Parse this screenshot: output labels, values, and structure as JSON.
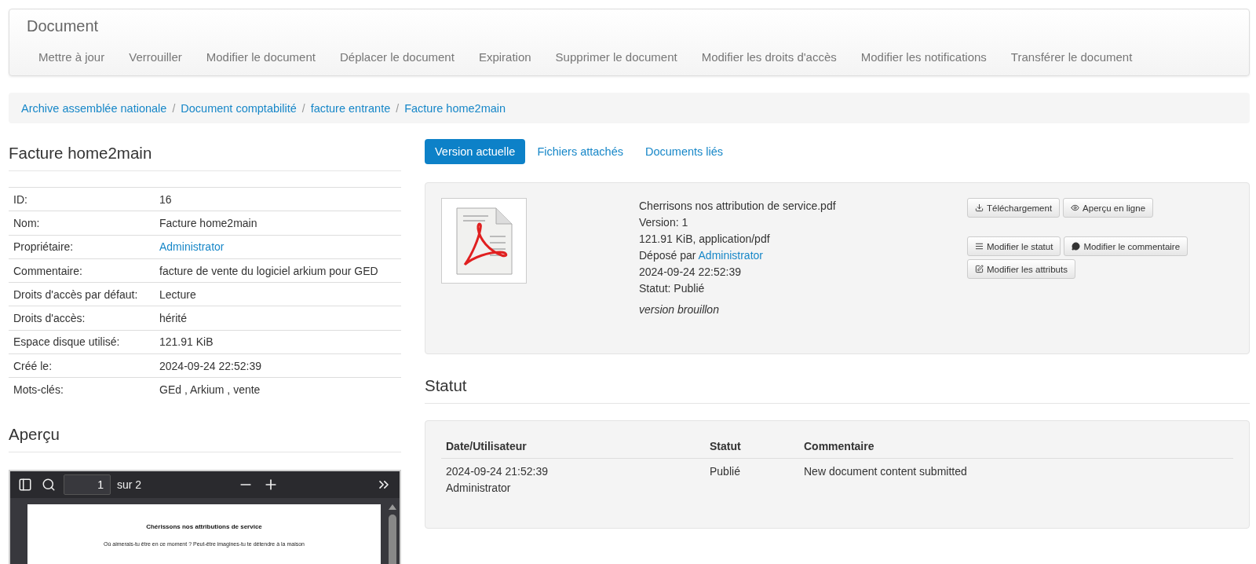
{
  "navbar": {
    "title": "Document",
    "items": [
      "Mettre à jour",
      "Verrouiller",
      "Modifier le document",
      "Déplacer le document",
      "Expiration",
      "Supprimer le document",
      "Modifier les droits d'accès",
      "Modifier les notifications",
      "Transférer le document"
    ]
  },
  "breadcrumb_separator": "/",
  "breadcrumb": [
    "Archive assemblée nationale",
    "Document comptabilité",
    "facture entrante",
    "Facture home2main"
  ],
  "details": {
    "title": "Facture home2main",
    "rows": [
      {
        "label": "ID:",
        "value": "16",
        "kind": "text"
      },
      {
        "label": "Nom:",
        "value": "Facture home2main",
        "kind": "text"
      },
      {
        "label": "Propriétaire:",
        "value": "Administrator",
        "kind": "link"
      },
      {
        "label": "Commentaire:",
        "value": "facture de vente du logiciel arkium pour GED",
        "kind": "text"
      },
      {
        "label": "Droits d'accès par défaut:",
        "value": "Lecture",
        "kind": "text"
      },
      {
        "label": "Droits d'accès:",
        "value": "hérité",
        "kind": "text"
      },
      {
        "label": "Espace disque utilisé:",
        "value": "121.91 KiB",
        "kind": "text"
      },
      {
        "label": "Créé le:",
        "value": "2024-09-24 22:52:39",
        "kind": "text"
      },
      {
        "label": "Mots-clés:",
        "value": "GEd , Arkium , vente",
        "kind": "text"
      }
    ]
  },
  "preview": {
    "title": "Aperçu",
    "viewer": {
      "page": "1",
      "page_count": "sur 2",
      "doc_title": "Chérissons nos attributions de service",
      "doc_text": "Où aimerais-tu être en ce moment ? Peut-être imagines-tu te détendre à la maison"
    }
  },
  "tabs": [
    {
      "label": "Version actuelle",
      "selected": true
    },
    {
      "label": "Fichiers attachés",
      "selected": false
    },
    {
      "label": "Documents liés",
      "selected": false
    }
  ],
  "version": {
    "filename": "Cherrisons nos attribution de service.pdf",
    "version": "Version: 1",
    "size": "121.91 KiB, application/pdf",
    "uploaded_label": "Déposé par",
    "uploaded_by": "Administrator",
    "date": "2024-09-24 22:52:39",
    "status": "Statut: Publié",
    "comment": "version brouillon",
    "button_rows": [
      [
        {
          "label": "Téléchargement",
          "kind": "download"
        },
        {
          "label": "Aperçu en ligne",
          "kind": "view"
        }
      ],
      [
        {
          "label": "Modifier le statut",
          "kind": "list"
        },
        {
          "label": "Modifier le commentaire",
          "kind": "comment"
        }
      ],
      [
        {
          "label": "Modifier les attributs",
          "kind": "edit"
        }
      ]
    ]
  },
  "status": {
    "title": "Statut",
    "columns": [
      "Date/Utilisateur",
      "Statut",
      "Commentaire"
    ],
    "rows": [
      {
        "date": "2024-09-24 21:52:39",
        "user": "Administrator",
        "status": "Publié",
        "comment": "New document content submitted"
      }
    ]
  }
}
